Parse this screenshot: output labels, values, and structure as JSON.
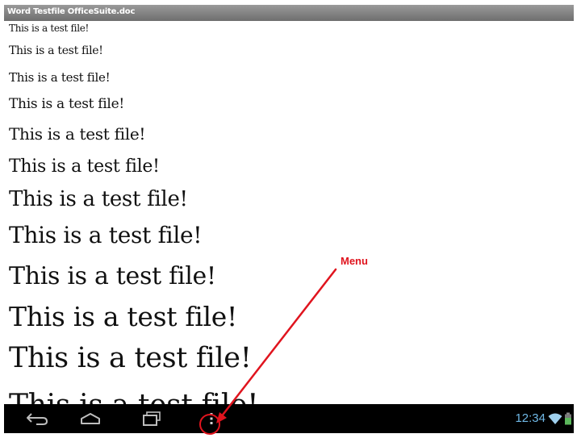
{
  "app": {
    "title": "Word Testfile OfficeSuite.doc"
  },
  "document": {
    "lines": [
      "This is a test file!",
      "This is a test file!",
      "This is a test file!",
      "This is a test file!",
      "This is a test file!",
      "This is a test file!",
      "This is a test file!",
      "This is a test file!",
      "This is a test file!",
      "This is a test file!",
      "This is a test file!",
      "This is a test file!"
    ]
  },
  "annotation": {
    "label": "Menu",
    "color": "#e0141e"
  },
  "navbar": {
    "buttons": {
      "back": "back-icon",
      "home": "home-icon",
      "recent": "recent-apps-icon",
      "menu": "menu-icon"
    }
  },
  "status": {
    "time": "12:34",
    "icons": [
      "wifi-icon",
      "battery-icon"
    ],
    "accent_color": "#6fb8e6"
  }
}
